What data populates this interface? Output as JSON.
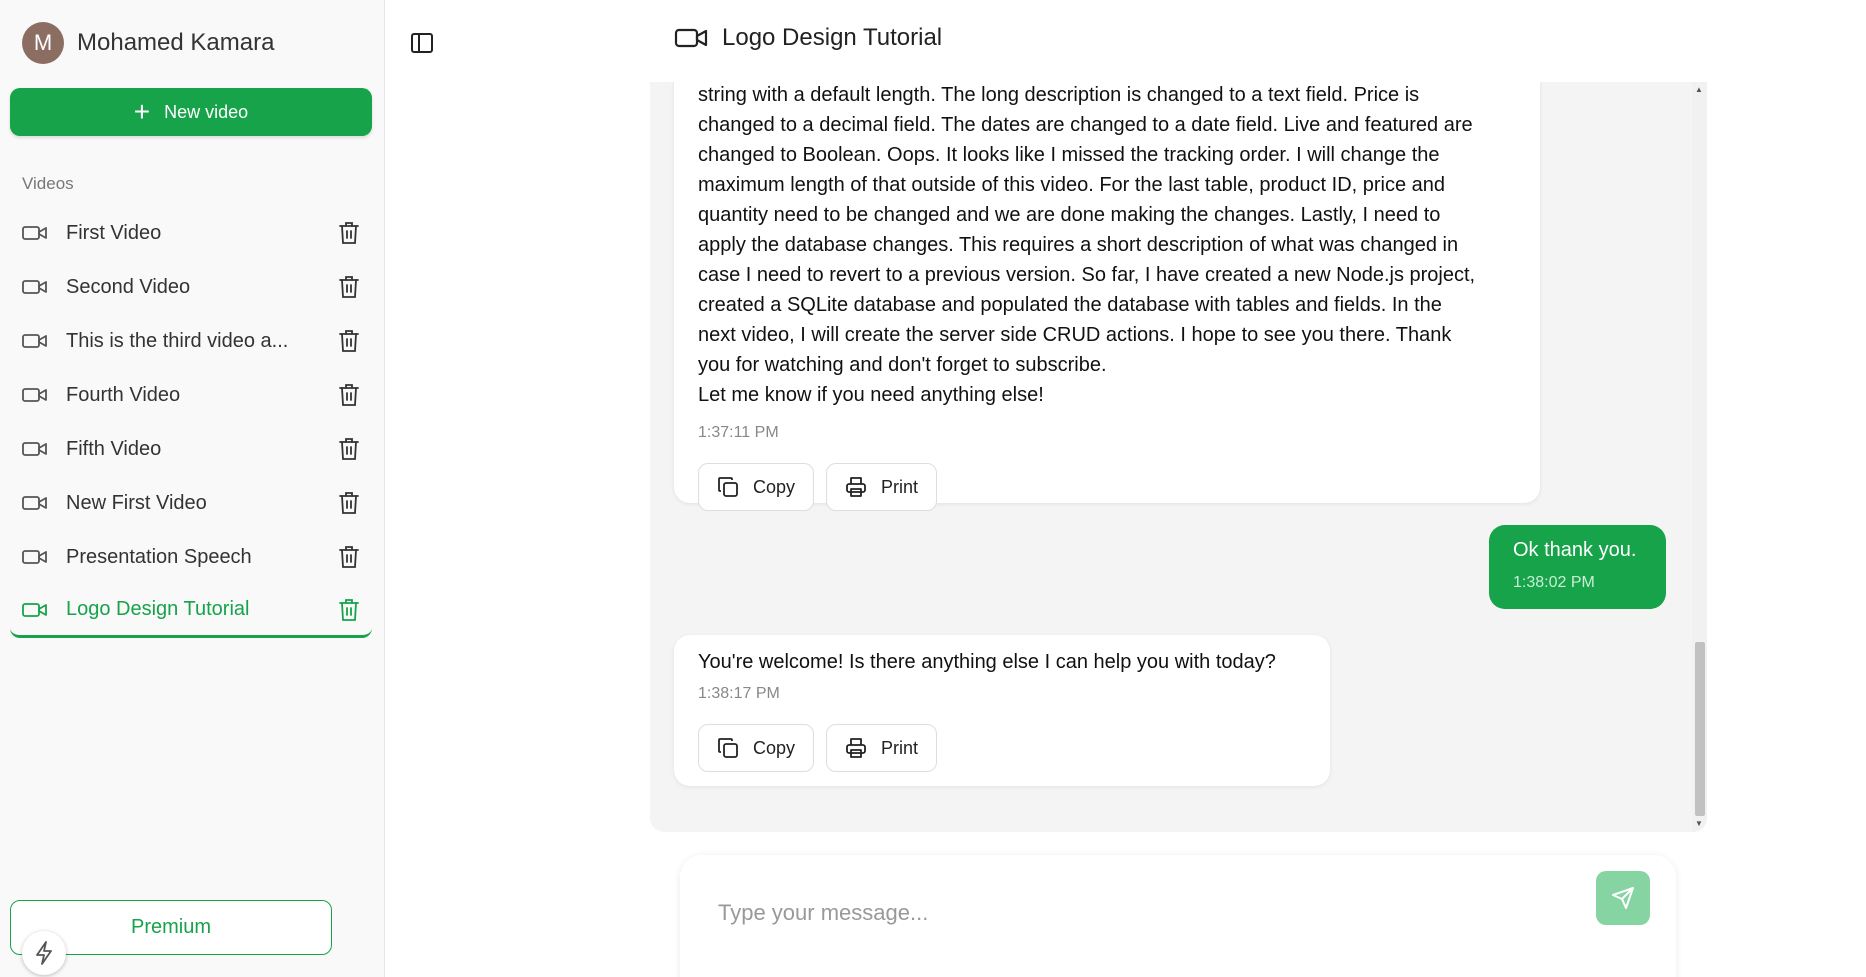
{
  "user": {
    "initial": "M",
    "name": "Mohamed Kamara"
  },
  "sidebar": {
    "new_video_label": "New video",
    "section_label": "Videos",
    "items": [
      {
        "label": "First Video",
        "active": false
      },
      {
        "label": "Second Video",
        "active": false
      },
      {
        "label": "This is the third video a...",
        "active": false
      },
      {
        "label": "Fourth Video",
        "active": false
      },
      {
        "label": "Fifth Video",
        "active": false
      },
      {
        "label": "New First Video",
        "active": false
      },
      {
        "label": "Presentation Speech",
        "active": false
      },
      {
        "label": "Logo Design Tutorial",
        "active": true
      }
    ],
    "premium_label": "Premium"
  },
  "header": {
    "title": "Logo Design Tutorial"
  },
  "messages": [
    {
      "role": "assistant",
      "text_lines": [
        "string with a default length. The long description is changed to a text field. Price is",
        "changed to a decimal field. The dates are changed to a date field. Live and featured are",
        "changed to Boolean. Oops. It looks like I missed the tracking order. I will change the",
        "maximum length of that outside of this video. For the last table, product ID, price and",
        "quantity need to be changed and we are done making the changes. Lastly, I need to",
        "apply the database changes. This requires a short description of what was changed in",
        "case I need to revert to a previous version. So far, I have created a new Node.js project,",
        "created a SQLite database and populated the database with tables and fields. In the",
        "next video, I will create the server side CRUD actions. I hope to see you there. Thank",
        "you for watching and don't forget to subscribe.",
        "Let me know if you need anything else!"
      ],
      "time": "1:37:11 PM",
      "copy_label": "Copy",
      "print_label": "Print"
    },
    {
      "role": "user",
      "text": "Ok thank you.",
      "time": "1:38:02 PM"
    },
    {
      "role": "assistant",
      "text": "You're welcome! Is there anything else I can help you with today?",
      "time": "1:38:17 PM",
      "copy_label": "Copy",
      "print_label": "Print"
    }
  ],
  "composer": {
    "placeholder": "Type your message...",
    "value": ""
  },
  "colors": {
    "accent": "#16a34a",
    "send_disabled": "#86d4a2",
    "avatar": "#8c6d62"
  },
  "icons": {
    "sidebar_item": "video-camera-icon",
    "delete": "trash-icon",
    "toggle": "sidebar-toggle-icon",
    "copy": "copy-icon",
    "print": "printer-icon",
    "send": "send-icon",
    "bolt": "lightning-icon"
  }
}
